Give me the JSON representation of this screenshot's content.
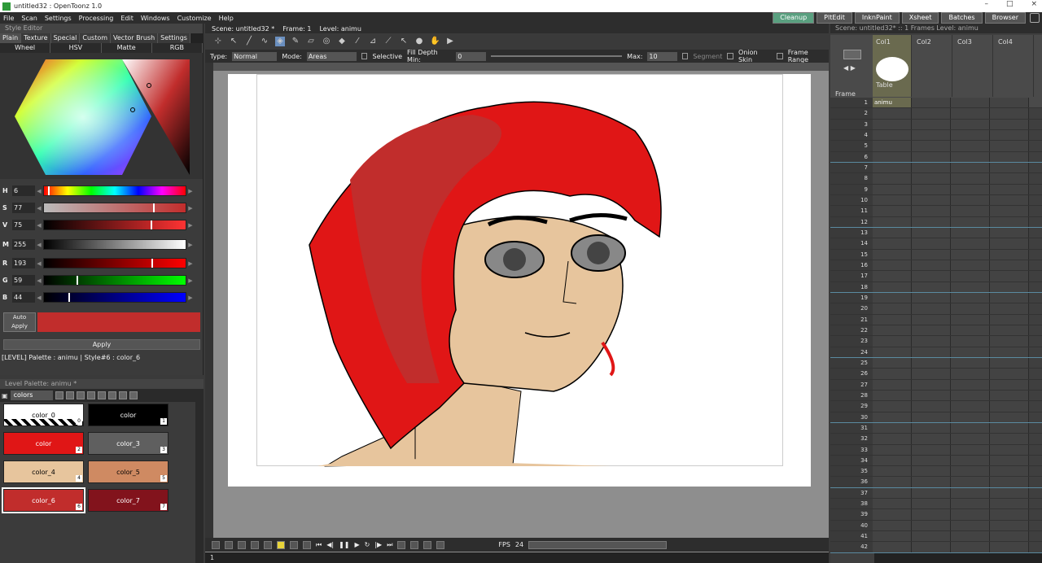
{
  "window": {
    "title": "untitled32 : OpenToonz 1.0",
    "controls": [
      "–",
      "□",
      "×"
    ]
  },
  "menu": [
    "File",
    "Scan",
    "Settings",
    "Processing",
    "Edit",
    "Windows",
    "Customize",
    "Help"
  ],
  "rooms": [
    "Cleanup",
    "PltEdit",
    "InknPaint",
    "Xsheet",
    "Batches",
    "Browser"
  ],
  "style_editor": {
    "title": "Style Editor",
    "tabs": [
      "Plain",
      "Texture",
      "Special",
      "Custom",
      "Vector Brush",
      "Settings"
    ],
    "subtabs": [
      "Wheel",
      "HSV",
      "Matte",
      "RGB"
    ],
    "sliders": [
      {
        "label": "H",
        "value": "6"
      },
      {
        "label": "S",
        "value": "77"
      },
      {
        "label": "V",
        "value": "75"
      },
      {
        "label": "M",
        "value": "255"
      },
      {
        "label": "R",
        "value": "193"
      },
      {
        "label": "G",
        "value": "59"
      },
      {
        "label": "B",
        "value": "44"
      }
    ],
    "auto_apply": "Auto Apply",
    "apply": "Apply",
    "status": "[LEVEL]  Palette : animu | Style#6 : color_6",
    "current_color": "#c12d2c"
  },
  "palette": {
    "title": "Level Palette: animu *",
    "name": "colors",
    "chips": [
      {
        "label": "color_0",
        "num": "0",
        "color": "#ffffff"
      },
      {
        "label": "color",
        "num": "1",
        "color": "#000000"
      },
      {
        "label": "color",
        "num": "2",
        "color": "#e01616"
      },
      {
        "label": "color_3",
        "num": "3",
        "color": "#5f5f5f"
      },
      {
        "label": "color_4",
        "num": "4",
        "color": "#e7c59d"
      },
      {
        "label": "color_5",
        "num": "5",
        "color": "#cf8a62"
      },
      {
        "label": "color_6",
        "num": "6",
        "color": "#c12d2c"
      },
      {
        "label": "color_7",
        "num": "7",
        "color": "#82131c"
      }
    ]
  },
  "viewer": {
    "scene": "Scene: untitled32 *",
    "frame": "Frame: 1",
    "level": "Level: animu",
    "type_label": "Type:",
    "type_value": "Normal",
    "mode_label": "Mode:",
    "mode_value": "Areas",
    "selective": "Selective",
    "fill_depth": "Fill Depth Min:",
    "fill_min": "0",
    "max_label": "Max:",
    "max_value": "10",
    "segment": "Segment",
    "onion": "Onion Skin",
    "frame_range": "Frame Range",
    "fps_label": "FPS",
    "fps_value": "24",
    "frame_field": "1"
  },
  "xsheet": {
    "info": "Scene: untitled32*  ::  1 Frames  Level: animu",
    "frame_header": "Frame",
    "columns": [
      "Col1",
      "Col2",
      "Col3",
      "Col4"
    ],
    "table_label": "Table",
    "level_name": "animu",
    "rows": [
      "1",
      "2",
      "3",
      "4",
      "5",
      "6",
      "7",
      "8",
      "9",
      "10",
      "11",
      "12",
      "13",
      "14",
      "15",
      "16",
      "17",
      "18",
      "19",
      "20",
      "21",
      "22",
      "23",
      "24",
      "25",
      "26",
      "27",
      "28",
      "29",
      "30",
      "31",
      "32",
      "33",
      "34",
      "35",
      "36",
      "37",
      "38",
      "39",
      "40",
      "41",
      "42"
    ]
  }
}
